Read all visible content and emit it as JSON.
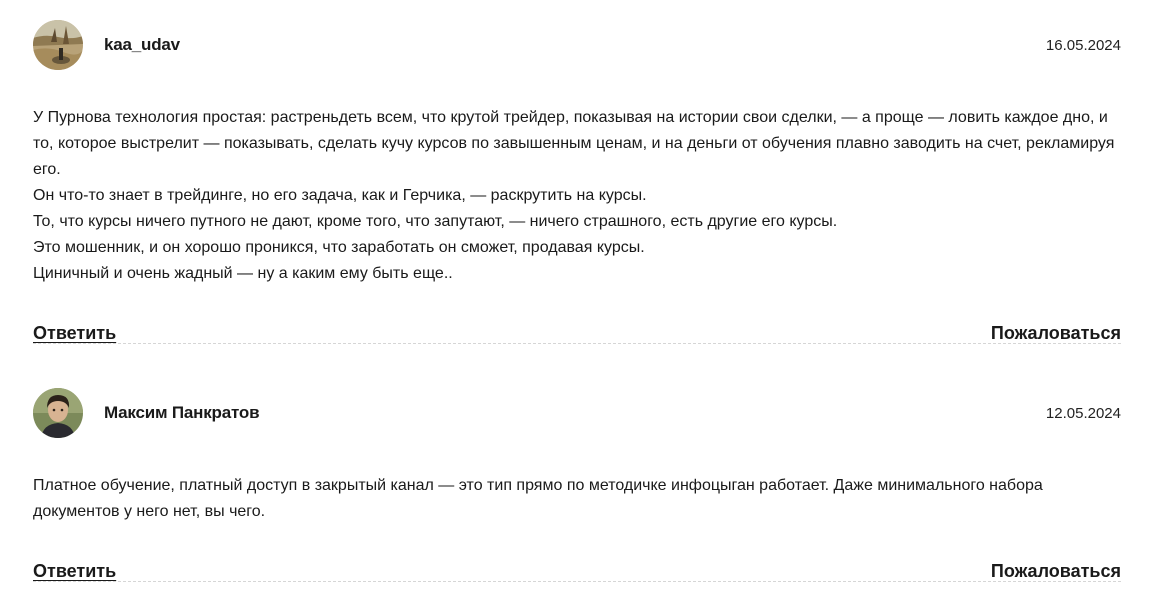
{
  "comments": [
    {
      "author": "kaa_udav",
      "date": "16.05.2024",
      "avatar_icon": "landscape-photo-avatar",
      "lines": [
        "У Пурнова технология простая: растреньдеть всем, что крутой трейдер, показывая на истории свои сделки, — а проще — ловить каждое дно, и то, которое выстрелит — показывать, сделать кучу курсов по завышенным ценам, и на деньги от обучения плавно заводить на счет, рекламируя его.",
        "Он что-то знает в трейдинге, но его задача, как и Герчика, — раскрутить на курсы.",
        "То, что курсы ничего путного не дают, кроме того, что запутают, — ничего страшного, есть другие его курсы.",
        "Это мошенник, и он хорошо проникся, что заработать он сможет, продавая курсы.",
        "Циничный и очень жадный — ну а каким ему быть еще.."
      ],
      "reply_label": "Ответить",
      "report_label": "Пожаловаться"
    },
    {
      "author": "Максим Панкратов",
      "date": "12.05.2024",
      "avatar_icon": "person-photo-avatar",
      "lines": [
        "Платное обучение, платный доступ в закрытый канал — это тип прямо по методичке инфоцыган работает. Даже минимального набора документов у него нет, вы чего."
      ],
      "reply_label": "Ответить",
      "report_label": "Пожаловаться"
    }
  ]
}
